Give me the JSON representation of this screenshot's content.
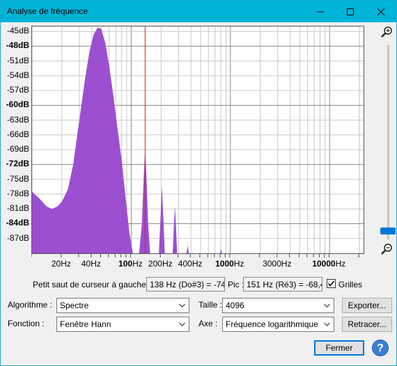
{
  "window": {
    "title": "Analyse de fréquence"
  },
  "plot": {
    "y_labels": [
      {
        "text": "-45dB",
        "db": -45,
        "bold": false
      },
      {
        "text": "-48dB",
        "db": -48,
        "bold": true
      },
      {
        "text": "-51dB",
        "db": -51,
        "bold": false
      },
      {
        "text": "-54dB",
        "db": -54,
        "bold": false
      },
      {
        "text": "-57dB",
        "db": -57,
        "bold": false
      },
      {
        "text": "-60dB",
        "db": -60,
        "bold": true
      },
      {
        "text": "-63dB",
        "db": -63,
        "bold": false
      },
      {
        "text": "-66dB",
        "db": -66,
        "bold": false
      },
      {
        "text": "-69dB",
        "db": -69,
        "bold": false
      },
      {
        "text": "-72dB",
        "db": -72,
        "bold": true
      },
      {
        "text": "-75dB",
        "db": -75,
        "bold": false
      },
      {
        "text": "-78dB",
        "db": -78,
        "bold": false
      },
      {
        "text": "-81dB",
        "db": -81,
        "bold": false
      },
      {
        "text": "-84dB",
        "db": -84,
        "bold": true
      },
      {
        "text": "-87dB",
        "db": -87,
        "bold": false
      }
    ],
    "x_labels": [
      {
        "num": "20",
        "unit": "Hz",
        "freq": 20,
        "bold": false
      },
      {
        "num": "40",
        "unit": "Hz",
        "freq": 40,
        "bold": false
      },
      {
        "num": "100",
        "unit": "Hz",
        "freq": 100,
        "bold": true
      },
      {
        "num": "200",
        "unit": "Hz",
        "freq": 200,
        "bold": false
      },
      {
        "num": "400",
        "unit": "Hz",
        "freq": 400,
        "bold": false
      },
      {
        "num": "1000",
        "unit": "Hz",
        "freq": 1000,
        "bold": true
      },
      {
        "num": "3000",
        "unit": "Hz",
        "freq": 3000,
        "bold": false
      },
      {
        "num": "10000",
        "unit": "Hz",
        "freq": 10000,
        "bold": true
      }
    ],
    "x_range_hz": [
      10,
      22000
    ],
    "y_range_db": [
      -44,
      -90
    ],
    "cursor_hz": 138,
    "fill_color": "#9b4fd0",
    "cursor_color": "#e0201f"
  },
  "chart_data": {
    "type": "area",
    "x_scale": "log",
    "xlim": [
      10,
      22000
    ],
    "ylim": [
      -90,
      -44
    ],
    "series": [
      {
        "values": [
          [
            10,
            -77.5
          ],
          [
            12,
            -79
          ],
          [
            14,
            -80.5
          ],
          [
            16,
            -81
          ],
          [
            18,
            -80.5
          ],
          [
            20,
            -79.5
          ],
          [
            23,
            -77
          ],
          [
            26,
            -72
          ],
          [
            30,
            -63
          ],
          [
            34,
            -55
          ],
          [
            38,
            -49
          ],
          [
            42,
            -45.5
          ],
          [
            46,
            -44.2
          ],
          [
            50,
            -44.5
          ],
          [
            55,
            -47.5
          ],
          [
            60,
            -52
          ],
          [
            66,
            -58
          ],
          [
            72,
            -64
          ],
          [
            80,
            -71
          ],
          [
            88,
            -79
          ],
          [
            96,
            -86
          ],
          [
            104,
            -90
          ],
          [
            120,
            -90
          ],
          [
            128,
            -84
          ],
          [
            134,
            -74
          ],
          [
            138,
            -69
          ],
          [
            142,
            -74
          ],
          [
            148,
            -84
          ],
          [
            155,
            -90
          ],
          [
            190,
            -90
          ],
          [
            198,
            -82
          ],
          [
            204,
            -76.5
          ],
          [
            210,
            -82
          ],
          [
            218,
            -90
          ],
          [
            262,
            -90
          ],
          [
            270,
            -84
          ],
          [
            276,
            -80.5
          ],
          [
            282,
            -84
          ],
          [
            290,
            -90
          ],
          [
            360,
            -90
          ],
          [
            372,
            -88.5
          ],
          [
            380,
            -90
          ],
          [
            790,
            -90
          ],
          [
            805,
            -89
          ],
          [
            820,
            -90
          ],
          [
            22000,
            -90
          ]
        ]
      }
    ]
  },
  "cursor_row": {
    "label": "Petit saut de curseur à gauche",
    "cursor_value": "138 Hz (Do#3) = -74",
    "peak_label": "Pic :",
    "peak_value": "151 Hz (Ré3) = -68,4",
    "grids_label": "Grilles",
    "grids_checked": true
  },
  "controls": {
    "algorithm_label": "Algorithme :",
    "algorithm_value": "Spectre",
    "size_label": "Taille :",
    "size_value": "4096",
    "export_button": "Exporter...",
    "function_label": "Fonction :",
    "function_value": "Fenêtre Hann",
    "axis_label": "Axe :",
    "axis_value": "Fréquence logarithmique",
    "replot_button": "Retracer...",
    "close_button": "Fermer",
    "help_button": "?"
  }
}
